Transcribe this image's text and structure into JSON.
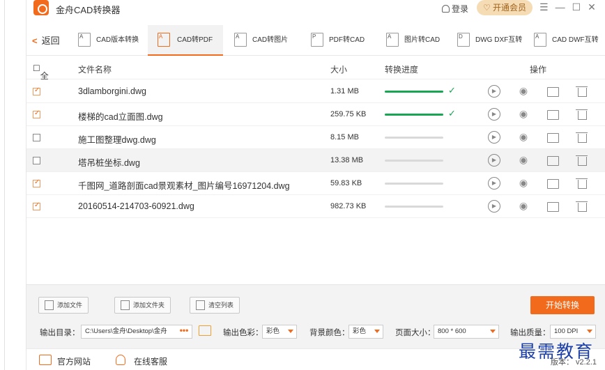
{
  "title_bar": {
    "app_title": "金舟CAD转换器",
    "login_label": "登录",
    "vip_label": "开通会员",
    "menu_glyph": "☰",
    "minimize_glyph": "—",
    "maximize_glyph": "☐",
    "close_glyph": "✕"
  },
  "toolbar": {
    "back_label": "返回",
    "tabs": [
      {
        "label": "CAD版本转换",
        "active": false
      },
      {
        "label": "CAD转PDF",
        "active": true
      },
      {
        "label": "CAD转图片",
        "active": false
      },
      {
        "label": "PDF转CAD",
        "active": false
      },
      {
        "label": "图片转CAD",
        "active": false
      },
      {
        "label": "DWG DXF互转",
        "active": false
      },
      {
        "label": "CAD DWF互转",
        "active": false
      }
    ]
  },
  "table": {
    "headers": {
      "select_all": "全选",
      "name": "文件名称",
      "size": "大小",
      "progress": "转换进度",
      "actions": "操作"
    },
    "rows": [
      {
        "checked": true,
        "name": "3dlamborgini.dwg",
        "size": "1.31 MB",
        "progress": 1.0,
        "done": true
      },
      {
        "checked": true,
        "name": "楼梯的cad立面图.dwg",
        "size": "259.75 KB",
        "progress": 1.0,
        "done": true
      },
      {
        "checked": false,
        "name": "施工图整理dwg.dwg",
        "size": "8.15 MB",
        "progress": 0.0,
        "done": false
      },
      {
        "checked": false,
        "name": "塔吊桩坐标.dwg",
        "size": "13.38 MB",
        "progress": 0.0,
        "done": false
      },
      {
        "checked": true,
        "name": "千图网_道路剖面cad景观素材_图片编号16971204.dwg",
        "size": "59.83 KB",
        "progress": 0.0,
        "done": false
      },
      {
        "checked": true,
        "name": "20160514-214703-60921.dwg",
        "size": "982.73 KB",
        "progress": 0.0,
        "done": false
      }
    ]
  },
  "bottom": {
    "add_file_label": "添加文件",
    "add_folder_label": "添加文件夹",
    "clear_list_label": "清空列表",
    "start_label": "开始转换",
    "output_dir_label": "输出目录：",
    "output_dir_value": "C:\\Users\\金舟\\Desktop\\金舟",
    "output_color_label": "输出色彩：",
    "output_color_value": "彩色",
    "bg_color_label": "背景颜色：",
    "bg_color_value": "彩色",
    "page_size_label": "页面大小：",
    "page_size_value": "800 * 600",
    "quality_label": "输出质量：",
    "quality_value": "100 DPI"
  },
  "footer": {
    "official_site_label": "官方网站",
    "online_service_label": "在线客服",
    "version_label": "版本： v2.2.1",
    "watermark_text": "最需教育"
  },
  "colors": {
    "accent": "#f26a1b",
    "success": "#19a653",
    "vip_bg": "#f5dcb5",
    "watermark": "#1c3fa8"
  }
}
